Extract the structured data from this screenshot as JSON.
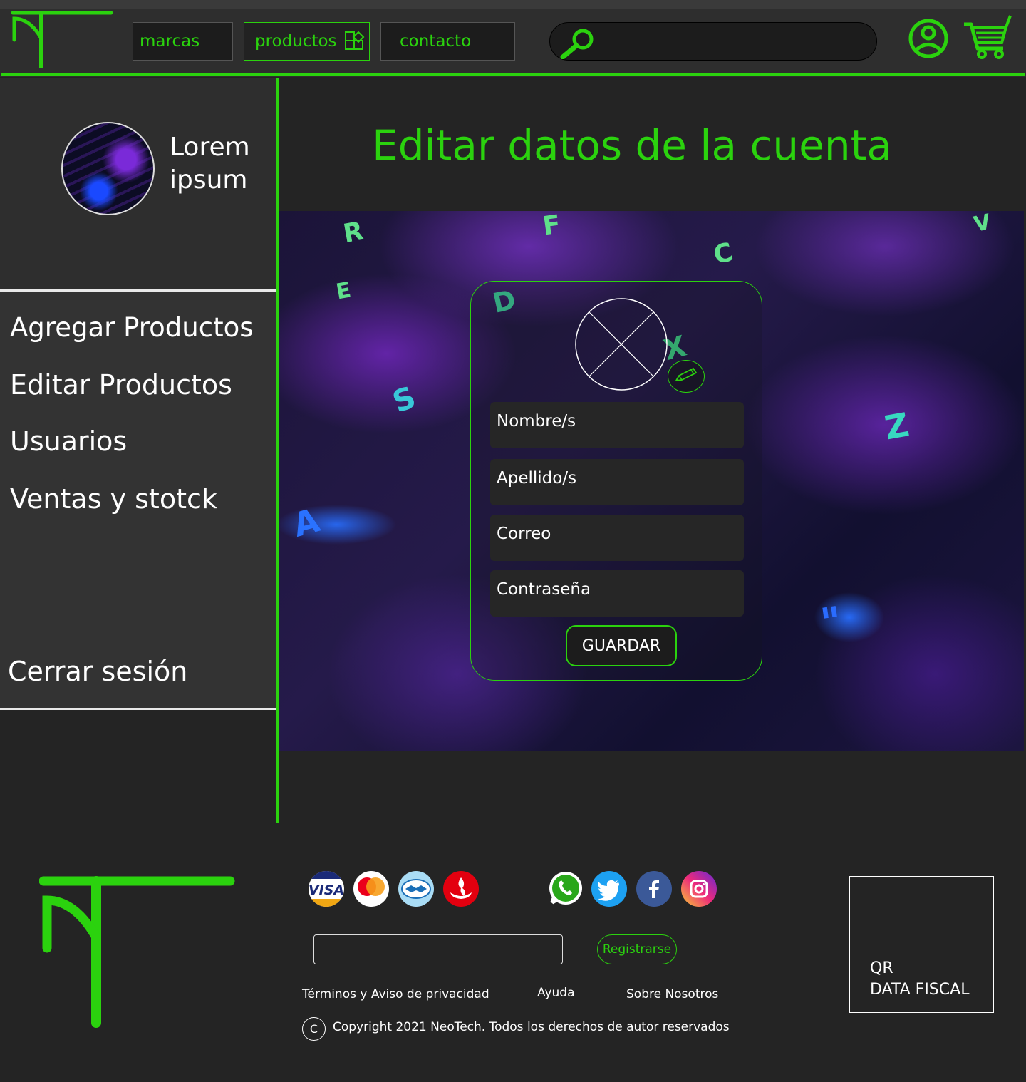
{
  "header": {
    "nav": [
      {
        "label": "marcas"
      },
      {
        "label": "productos"
      },
      {
        "label": "contacto"
      }
    ],
    "search": {
      "placeholder": ""
    }
  },
  "sidebar": {
    "profile_name": "Lorem ipsum",
    "menu": [
      {
        "label": "Agregar Productos"
      },
      {
        "label": "Editar Productos"
      },
      {
        "label": "Usuarios"
      },
      {
        "label": "Ventas y stotck"
      }
    ],
    "logout_label": "Cerrar sesión"
  },
  "main": {
    "title": "Editar datos de la cuenta",
    "form": {
      "fields": [
        {
          "placeholder": "Nombre/s"
        },
        {
          "placeholder": "Apellido/s"
        },
        {
          "placeholder": "Correo"
        },
        {
          "placeholder": "Contraseña"
        }
      ],
      "save_label": "GUARDAR"
    }
  },
  "footer": {
    "payment_methods": [
      "visa-icon",
      "mastercard-icon",
      "mercadopago-icon",
      "santander-icon"
    ],
    "social": [
      "whatsapp-icon",
      "twitter-icon",
      "facebook-icon",
      "instagram-icon"
    ],
    "newsletter": {
      "placeholder": "",
      "register_label": "Registrarse"
    },
    "links": [
      {
        "label": "Términos y Aviso de privacidad"
      },
      {
        "label": "Ayuda"
      },
      {
        "label": "Sobre Nosotros"
      }
    ],
    "copyright_symbol": "C",
    "copyright": "Copyright 2021 NeoTech. Todos los derechos de autor reservados",
    "qr_label": "QR\nDATA FISCAL"
  },
  "colors": {
    "accent": "#2bd20e",
    "background": "#242424",
    "header": "#2e2e2e",
    "menu": "#333333"
  }
}
